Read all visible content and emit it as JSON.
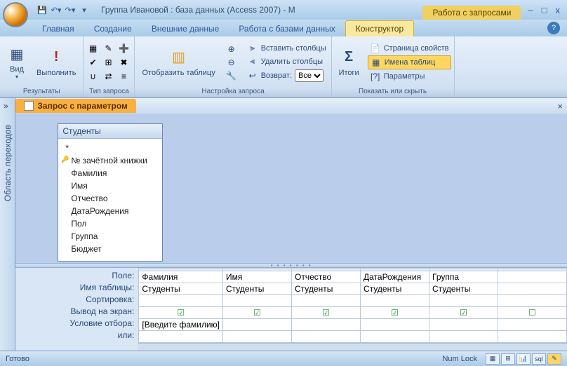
{
  "title": "Группа Ивановой : база данных (Access 2007) - M",
  "context_tab_title": "Работа с запросами",
  "win_controls": {
    "min": "–",
    "max": "□",
    "close": "x"
  },
  "tabs": {
    "home": "Главная",
    "create": "Создание",
    "external": "Внешние данные",
    "dbtools": "Работа с базами данных",
    "design": "Конструктор"
  },
  "ribbon": {
    "results": {
      "view": "Вид",
      "run": "Выполнить",
      "label": "Результаты"
    },
    "qtype": {
      "label": "Тип запроса"
    },
    "setup": {
      "show_table": "Отобразить таблицу",
      "insert_cols": "Вставить столбцы",
      "delete_cols": "Удалить столбцы",
      "return": "Возврат:",
      "return_val": "Все",
      "label": "Настройка запроса"
    },
    "totals": {
      "btn": "Итоги"
    },
    "showhide": {
      "prop_sheet": "Страница свойств",
      "table_names": "Имена таблиц",
      "params": "Параметры",
      "label": "Показать или скрыть"
    }
  },
  "navpane": {
    "label": "Область переходов",
    "toggle": "»"
  },
  "obj_tab": "Запрос с параметром",
  "table_box": {
    "title": "Студенты",
    "fields": [
      "*",
      "№ зачётной книжки",
      "Фамилия",
      "Имя",
      "Отчество",
      "ДатаРождения",
      "Пол",
      "Группа",
      "Бюджет"
    ],
    "pk_index": 1
  },
  "grid": {
    "rows": {
      "field": "Поле:",
      "table": "Имя таблицы:",
      "sort": "Сортировка:",
      "show": "Вывод на экран:",
      "criteria": "Условие отбора:",
      "or": "или:"
    },
    "cols": [
      {
        "field": "Фамилия",
        "table": "Студенты",
        "show": true,
        "criteria": "[Введите фамилию]"
      },
      {
        "field": "Имя",
        "table": "Студенты",
        "show": true,
        "criteria": ""
      },
      {
        "field": "Отчество",
        "table": "Студенты",
        "show": true,
        "criteria": ""
      },
      {
        "field": "ДатаРождения",
        "table": "Студенты",
        "show": true,
        "criteria": ""
      },
      {
        "field": "Группа",
        "table": "Студенты",
        "show": true,
        "criteria": ""
      },
      {
        "field": "",
        "table": "",
        "show": false,
        "criteria": ""
      }
    ]
  },
  "status": {
    "ready": "Готово",
    "numlock": "Num Lock"
  }
}
